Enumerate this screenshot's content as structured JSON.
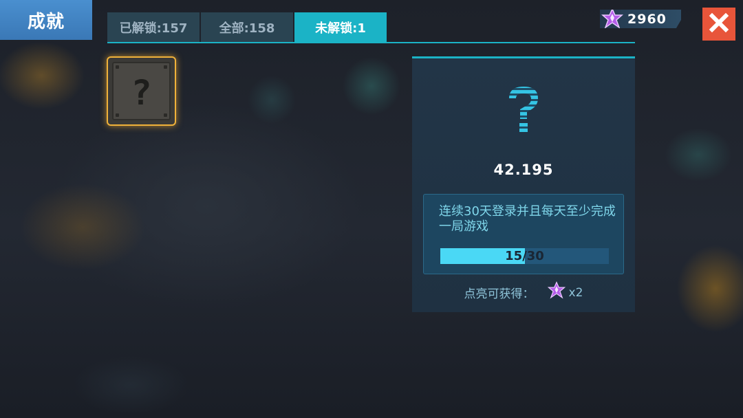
{
  "title": "成就",
  "tabs": [
    {
      "label": "已解锁:157",
      "active": false
    },
    {
      "label": "全部:158",
      "active": false
    },
    {
      "label": "未解锁:1",
      "active": true
    }
  ],
  "currency": {
    "amount": "2960",
    "icon": "purple-star-gem-icon"
  },
  "close_icon": "close-icon",
  "achievements": [
    {
      "icon": "question-mark-icon",
      "locked": true,
      "selected": true
    }
  ],
  "details": {
    "name": "42.195",
    "description": "连续30天登录并且每天至少完成一局游戏",
    "progress_text": "15/30",
    "progress_fraction": 0.5,
    "reward_label": "点亮可获得：",
    "reward_amount": "x2",
    "reward_icon": "purple-star-gem-icon"
  },
  "colors": {
    "accent": "#1bb3c6",
    "title_bg": "#4a8fcf",
    "close_bg": "#e8553a",
    "selected_border": "#f0b23a",
    "progress_fill": "#4ad8f5"
  }
}
